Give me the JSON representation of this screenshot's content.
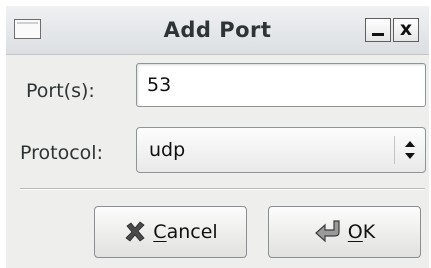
{
  "window": {
    "title": "Add Port"
  },
  "titlebar": {
    "minimize_icon": "minimize-icon",
    "close_label": "x"
  },
  "form": {
    "ports_label": "Port(s):",
    "ports_value": "53",
    "protocol_label": "Protocol:",
    "protocol_value": "udp"
  },
  "buttons": {
    "cancel_mnemonic": "C",
    "cancel_rest": "ancel",
    "cancel_icon": "cross-icon",
    "ok_mnemonic": "O",
    "ok_rest": "K",
    "ok_icon": "enter-arrow-icon"
  }
}
